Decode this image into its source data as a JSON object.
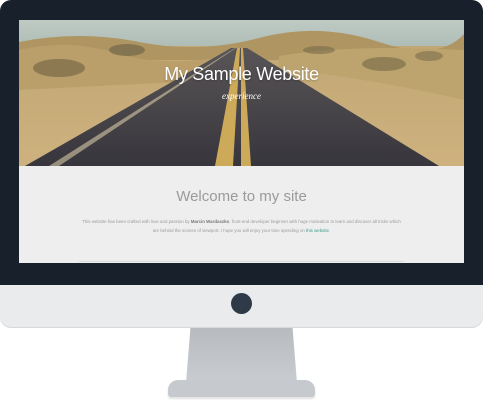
{
  "site": {
    "hero_title": "My Sample Website",
    "hero_subtitle": "experience",
    "welcome_heading": "Welcome to my site",
    "intro_before": "This website has been crafted with love and passion by ",
    "intro_author": "Marcin Wardaszko",
    "intro_middle": ", front-end developer beginner with huge motivation to learn and discover all tricks which are behind the scenes of viewport. I hope you will enjoy your time spending on ",
    "intro_link": "this website",
    "intro_after": "."
  },
  "colors": {
    "bezel": "#18212b",
    "accent_link": "#3a9b88",
    "heading_grey": "#9a9a9a"
  }
}
